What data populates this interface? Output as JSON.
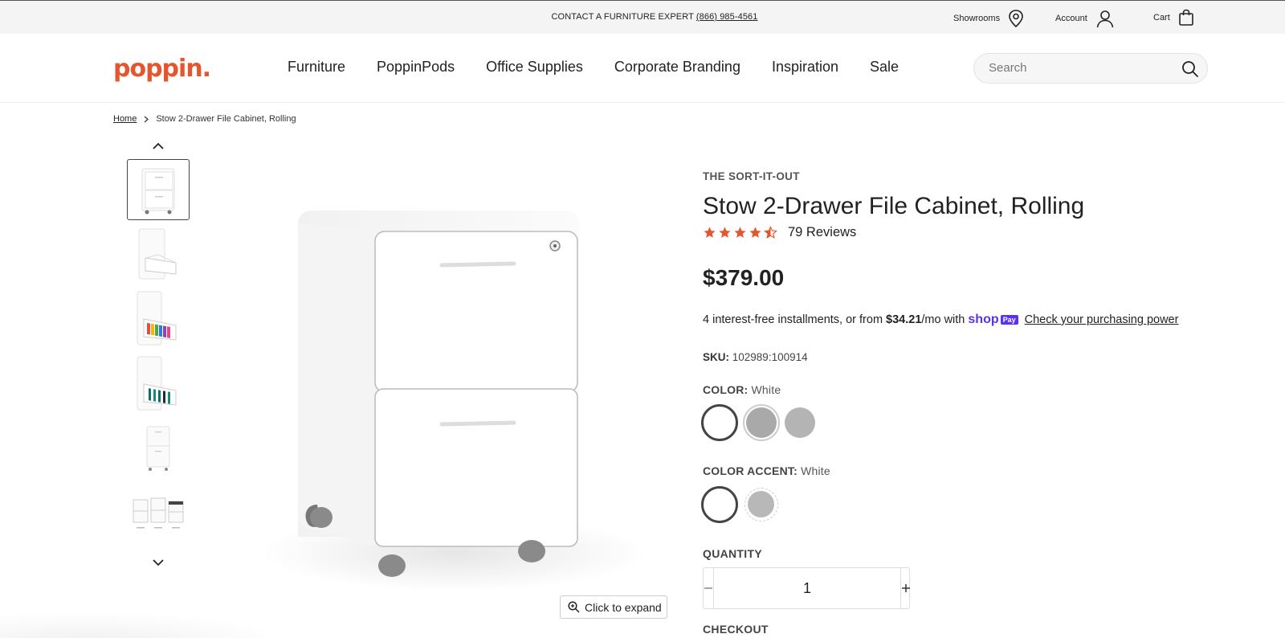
{
  "topbar": {
    "contact_text": "CONTACT A FURNITURE EXPERT",
    "phone": "(866) 985-4561",
    "showrooms_label": "Showrooms",
    "account_label": "Account",
    "cart_label": "Cart"
  },
  "header": {
    "logo": "poppin.",
    "nav": [
      "Furniture",
      "PoppinPods",
      "Office Supplies",
      "Corporate Branding",
      "Inspiration",
      "Sale"
    ],
    "search_placeholder": "Search"
  },
  "breadcrumb": {
    "home": "Home",
    "current": "Stow 2-Drawer File Cabinet, Rolling"
  },
  "gallery": {
    "thumbnail_count": 6,
    "active_index": 0,
    "expand_label": "Click to expand"
  },
  "product": {
    "collection": "THE SORT-IT-OUT",
    "title": "Stow 2-Drawer File Cabinet, Rolling",
    "rating": 4.5,
    "reviews": "79 Reviews",
    "price": "$379.00",
    "installments_prefix": "4 interest-free installments, or from",
    "installments_amount": "$34.21",
    "installments_suffix": "/mo with",
    "shop_pay": "shop",
    "shop_pay_badge": "Pay",
    "purchasing_power_link": "Check your purchasing power",
    "sku_label": "SKU:",
    "sku_value": "102989:100914",
    "color_label": "COLOR:",
    "color_value": "White",
    "color_swatches": [
      "#ffffff",
      "#a9a9a9",
      "#b4b4b4"
    ],
    "accent_label": "COLOR ACCENT:",
    "accent_value": "White",
    "accent_swatches": [
      "#ffffff",
      "#b8b8b8"
    ],
    "quantity_label": "QUANTITY",
    "quantity_value": "1",
    "checkout_label": "CHECKOUT"
  },
  "colors": {
    "brand": "#e4572e",
    "star": "#e4572e",
    "shoppay": "#5a31f4"
  }
}
